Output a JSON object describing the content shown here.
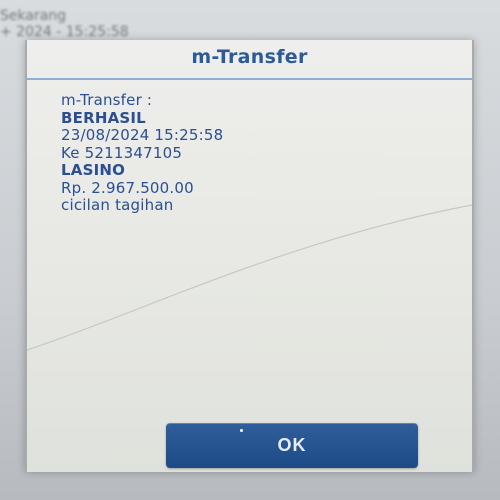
{
  "background": {
    "line1": "Sekarang",
    "line2": "+ 2024 - 15:25:58"
  },
  "dialog": {
    "title": "m-Transfer",
    "lines": [
      "m-Transfer :",
      "BERHASIL",
      "23/08/2024 15:25:58",
      "Ke 5211347105",
      "LASINO",
      "Rp. 2.967.500.00",
      "cicilan tagihan"
    ],
    "ok_label": "OK"
  },
  "colors": {
    "accent": "#2c5b95",
    "button": "#1f4d8b"
  }
}
